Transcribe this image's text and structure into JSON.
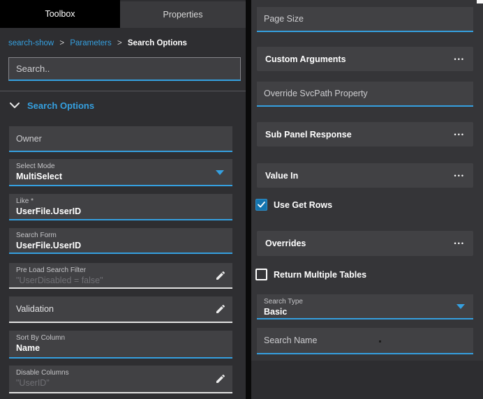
{
  "colors": {
    "accent": "#35a0e0",
    "checkbox_fill": "#1474ae",
    "active_tab_bg": "#000000",
    "field_bg": "#414144",
    "panel_bg": "#2e2e31"
  },
  "tabs": {
    "toolbox": "Toolbox",
    "properties": "Properties"
  },
  "breadcrumb": {
    "sep": ">",
    "items": [
      {
        "label": "search-show"
      },
      {
        "label": "Parameters"
      },
      {
        "label": "Search Options"
      }
    ]
  },
  "search": {
    "placeholder": "Search.."
  },
  "section": {
    "title": "Search Options",
    "icon": "chevron-down"
  },
  "fields": {
    "owner": {
      "label": "Owner"
    },
    "select_mode": {
      "label": "Select Mode",
      "value": "MultiSelect"
    },
    "like": {
      "label": "Like *",
      "value": "UserFile.UserID"
    },
    "search_form": {
      "label": "Search Form",
      "value": "UserFile.UserID"
    },
    "pre_load_search_filter": {
      "label": "Pre Load Search Filter",
      "value": "\"UserDisabled = false\""
    },
    "validation": {
      "label": "Validation"
    },
    "sort_by_column": {
      "label": "Sort By Column",
      "value": "Name"
    },
    "disable_columns": {
      "label": "Disable Columns",
      "value": "\"UserID\""
    },
    "page_size": {
      "label": "Page Size"
    },
    "custom_arguments": {
      "label": "Custom Arguments",
      "more": "•••"
    },
    "override_svcpath": {
      "label": "Override SvcPath Property"
    },
    "sub_panel_response": {
      "label": "Sub Panel Response",
      "more": "•••"
    },
    "value_in": {
      "label": "Value In",
      "more": "•••"
    },
    "use_get_rows": {
      "label": "Use Get Rows",
      "checked": true
    },
    "overrides": {
      "label": "Overrides",
      "more": "•••"
    },
    "return_multiple_tables": {
      "label": "Return Multiple Tables",
      "checked": false
    },
    "search_type": {
      "label": "Search Type",
      "value": "Basic"
    },
    "search_name": {
      "label": "Search Name"
    }
  }
}
